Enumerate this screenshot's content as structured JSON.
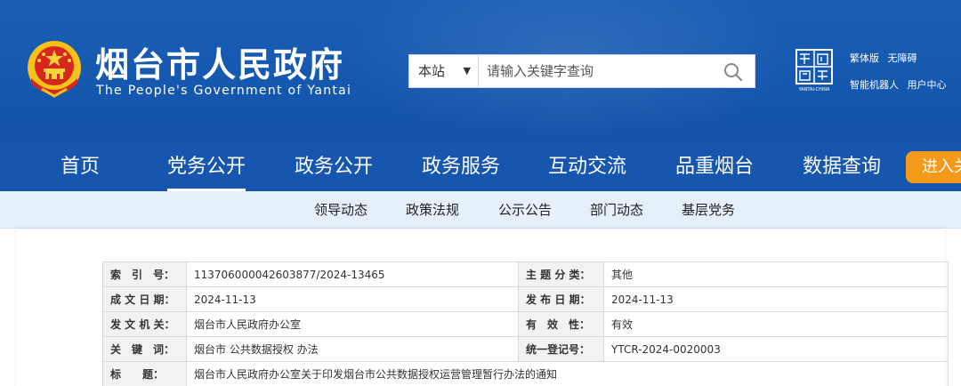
{
  "header": {
    "title_cn": "烟台市人民政府",
    "title_en": "The People's Government of Yantai",
    "seal_text": "YANTAI·CHINA"
  },
  "search": {
    "scope": "本站",
    "placeholder": "请输入关键字查询",
    "icon": "search-icon"
  },
  "utils": {
    "traditional": "繁体版",
    "accessible": "无障碍",
    "robot": "智能机器人",
    "user_center": "用户中心"
  },
  "nav": {
    "items": [
      "首页",
      "党务公开",
      "政务公开",
      "政务服务",
      "互动交流",
      "品重烟台",
      "数据查询"
    ],
    "active_index": 1,
    "enter_button": "进入关"
  },
  "subnav": {
    "items": [
      "领导动态",
      "政策法规",
      "公示公告",
      "部门动态",
      "基层党务"
    ]
  },
  "info": {
    "rows": [
      {
        "k1": "索　引　号：",
        "v1": "113706000042603877/2024-13465",
        "k2": "主 题 分 类：",
        "v2": "其他"
      },
      {
        "k1": "成 文 日 期：",
        "v1": "2024-11-13",
        "k2": "发 布 日 期：",
        "v2": "2024-11-13"
      },
      {
        "k1": "发 文 机 关：",
        "v1": "烟台市人民政府办公室",
        "k2": "有　效　性：",
        "v2": "有效"
      },
      {
        "k1": "关　键　词：",
        "v1": "烟台市 公共数据授权 办法",
        "k2": "统一登记号：",
        "v2": "YTCR-2024-0020003"
      }
    ],
    "title_label": "标　　题：",
    "title_value": "烟台市人民政府办公室关于印发烟台市公共数据授权运营管理暂行办法的通知"
  },
  "colors": {
    "header_blue": "#1558b0",
    "nav_blue": "#1656ae",
    "subnav_bg": "#e6f0fb",
    "accent_orange": "#f39a1b"
  }
}
